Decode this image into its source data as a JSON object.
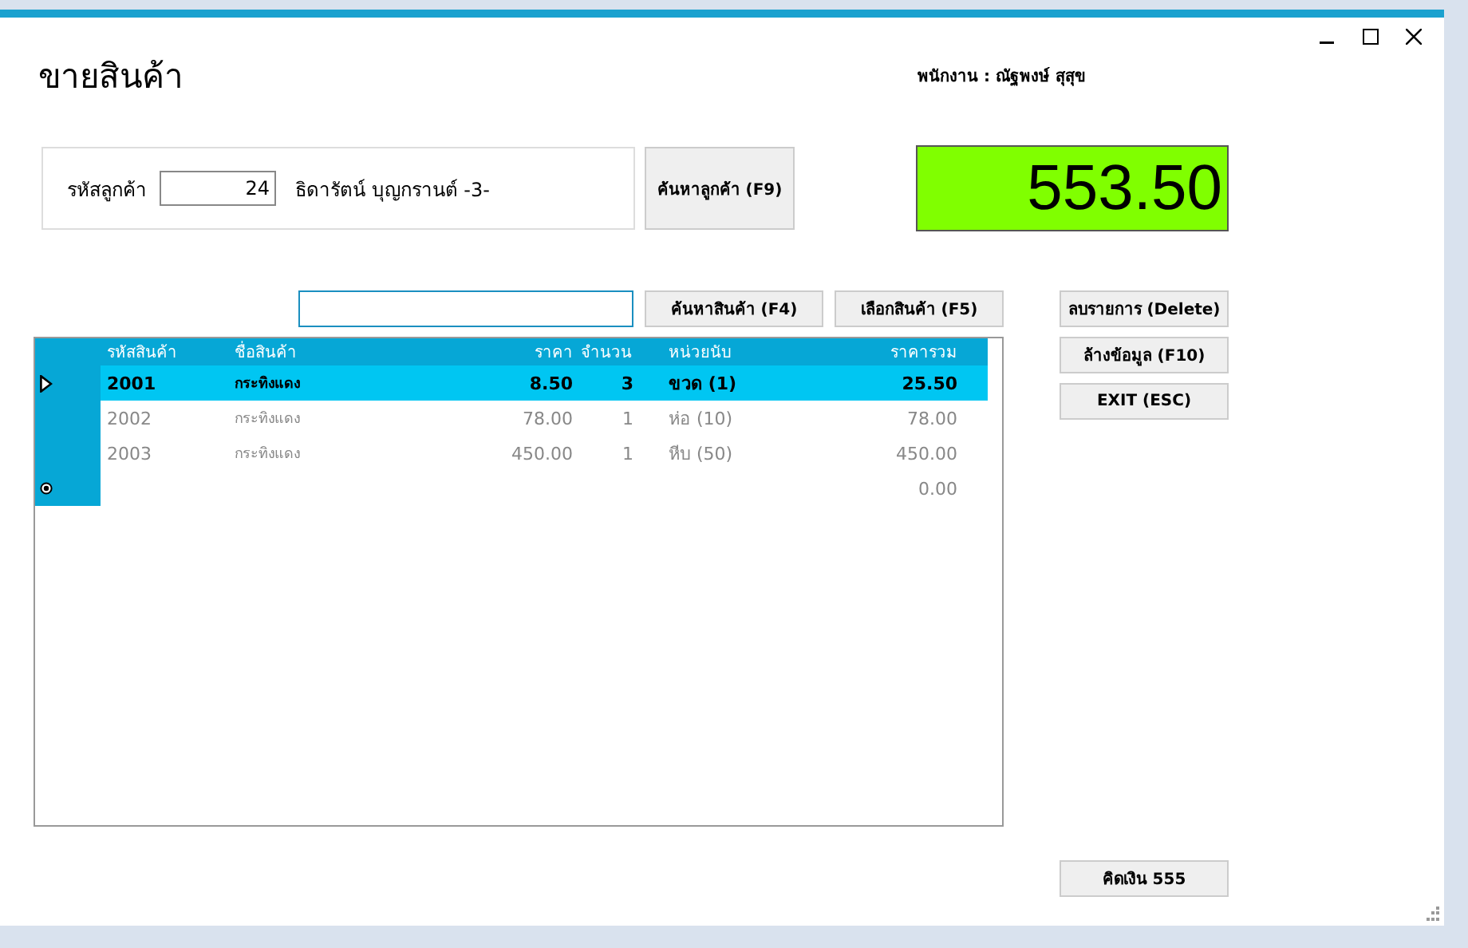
{
  "window": {
    "title": "ขายสินค้า"
  },
  "employee": "พนักงาน : ณัฐพงษ์ สุสุข",
  "customer": {
    "label": "รหัสลูกค้า",
    "code": "24",
    "name": "ธิดารัตน์ บุญกรานต์ -3-"
  },
  "search_customer_button": "ค้นหาลูกค้า (F9)",
  "total": "553.50",
  "product_search": {
    "focused": true
  },
  "product_buttons": [
    "ค้นหาสินค้า (F4)",
    "เลือกสินค้า (F5)"
  ],
  "side_buttons": [
    "ลบรายการ (Delete)",
    "ล้างข้อมูล (F10)",
    "EXIT (ESC)"
  ],
  "table": {
    "columns": [
      "รหัสสินค้า",
      "ชื่อสินค้า",
      "ราคา",
      "จำนวน",
      "หน่วยนับ",
      "ราคารวม"
    ],
    "rows": [
      {
        "cells": [
          "2001",
          "กระทิงแดง",
          "8.50",
          "3",
          "ขวด (1)",
          "25.50"
        ],
        "selected": true
      },
      {
        "cells": [
          "2002",
          "กระทิงแดง",
          "78.00",
          "1",
          "ห่อ (10)",
          "78.00"
        ],
        "selected": false
      },
      {
        "cells": [
          "2003",
          "กระทิงแดง",
          "450.00",
          "1",
          "หีบ (50)",
          "450.00"
        ],
        "selected": false
      }
    ],
    "new_row": {
      "total": "0.00"
    }
  },
  "checkout_button": "คิดเงิน 555"
}
